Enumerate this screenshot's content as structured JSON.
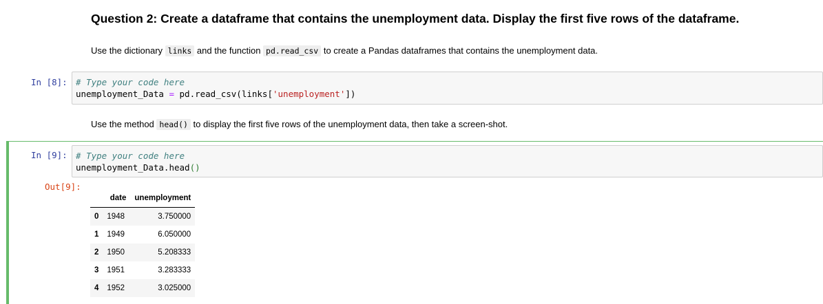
{
  "question": {
    "heading": "Question 2: Create a dataframe that contains the unemployment data. Display the first five rows of the dataframe."
  },
  "instruction1": {
    "part1": "Use the dictionary ",
    "code1": "links",
    "part2": " and the function ",
    "code2": "pd.read_csv",
    "part3": " to create a Pandas dataframes that contains the unemployment data."
  },
  "cell1": {
    "prompt": "In [8]:",
    "comment": "# Type your code here",
    "line2_a": "unemployment_Data ",
    "line2_op": "=",
    "line2_b": " pd.read_csv(links[",
    "line2_str": "'unemployment'",
    "line2_c": "])"
  },
  "instruction2": {
    "part1": "Use the method ",
    "code1": "head()",
    "part2": " to display the first five rows of the unemployment data, then take a screen-shot."
  },
  "cell2": {
    "prompt": "In [9]:",
    "comment": "# Type your code here",
    "line2_a": "unemployment_Data.head",
    "line2_paren": "()",
    "out_prompt": "Out[9]:"
  },
  "dataframe": {
    "columns": [
      "",
      "date",
      "unemployment"
    ],
    "rows": [
      {
        "index": "0",
        "date": "1948",
        "unemployment": "3.750000"
      },
      {
        "index": "1",
        "date": "1949",
        "unemployment": "6.050000"
      },
      {
        "index": "2",
        "date": "1950",
        "unemployment": "5.208333"
      },
      {
        "index": "3",
        "date": "1951",
        "unemployment": "3.283333"
      },
      {
        "index": "4",
        "date": "1952",
        "unemployment": "3.025000"
      }
    ]
  },
  "colors": {
    "in_prompt": "#303f9f",
    "out_prompt": "#d84315",
    "selected_cell": "#66bb6a",
    "comment": "#408080",
    "string": "#ba2121"
  }
}
